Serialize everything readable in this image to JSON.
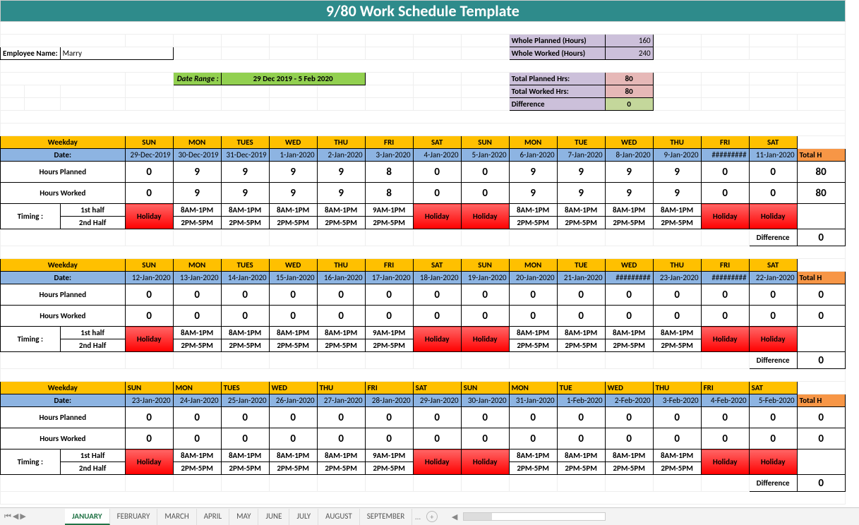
{
  "title": "9/80 Work Schedule Template",
  "emp_label": "Employee Name:",
  "emp_name": "Marry",
  "date_range_label": "Date Range :",
  "date_range_value": "29 Dec 2019 - 5 Feb 2020",
  "summary": {
    "whole_planned_lbl": "Whole Planned (Hours)",
    "whole_planned_val": "160",
    "whole_worked_lbl": "Whole Worked (Hours)",
    "whole_worked_val": "240",
    "total_planned_lbl": "Total Planned Hrs:",
    "total_planned_val": "80",
    "total_worked_lbl": "Total Worked Hrs:",
    "total_worked_val": "80",
    "diff_lbl": "Difference",
    "diff_val": "0"
  },
  "labels": {
    "weekday": "Weekday",
    "date": "Date:",
    "hp": "Hours Planned",
    "hw": "Hours Worked",
    "timing": "Timing :",
    "h1": "1st half",
    "h2": "2nd Half",
    "h1b": "1st Half",
    "diff": "Difference",
    "tot": "Total H"
  },
  "weeks": [
    {
      "days": [
        "SUN",
        "MON",
        "TUES",
        "WED",
        "THU",
        "FRI",
        "SAT",
        "SUN",
        "MON",
        "TUE",
        "WED",
        "THU",
        "FRI",
        "SAT"
      ],
      "dates": [
        "29-Dec-2019",
        "30-Dec-2019",
        "31-Dec-2019",
        "1-Jan-2020",
        "2-Jan-2020",
        "3-Jan-2020",
        "4-Jan-2020",
        "5-Jan-2020",
        "6-Jan-2020",
        "7-Jan-2020",
        "8-Jan-2020",
        "9-Jan-2020",
        "#########",
        "11-Jan-2020"
      ],
      "hp": [
        "0",
        "9",
        "9",
        "9",
        "9",
        "8",
        "0",
        "0",
        "9",
        "9",
        "9",
        "9",
        "0",
        "0"
      ],
      "hw": [
        "0",
        "9",
        "9",
        "9",
        "9",
        "8",
        "0",
        "0",
        "9",
        "9",
        "9",
        "9",
        "0",
        "0"
      ],
      "shift1": [
        "Holiday",
        "8AM-1PM",
        "8AM-1PM",
        "8AM-1PM",
        "8AM-1PM",
        "9AM-1PM",
        "Holiday",
        "Holiday",
        "8AM-1PM",
        "8AM-1PM",
        "8AM-1PM",
        "8AM-1PM",
        "Holiday",
        "Holiday"
      ],
      "shift2": [
        "",
        "2PM-5PM",
        "2PM-5PM",
        "2PM-5PM",
        "2PM-5PM",
        "2PM-5PM",
        "",
        "",
        "2PM-5PM",
        "2PM-5PM",
        "2PM-5PM",
        "2PM-5PM",
        "",
        ""
      ],
      "holiday": [
        true,
        false,
        false,
        false,
        false,
        false,
        true,
        true,
        false,
        false,
        false,
        false,
        true,
        true
      ],
      "thp": "80",
      "thw": "80",
      "diff": "0"
    },
    {
      "days": [
        "SUN",
        "MON",
        "TUES",
        "WED",
        "THU",
        "FRI",
        "SAT",
        "SUN",
        "MON",
        "TUE",
        "WED",
        "THU",
        "FRI",
        "SAT"
      ],
      "dates": [
        "12-Jan-2020",
        "13-Jan-2020",
        "14-Jan-2020",
        "15-Jan-2020",
        "16-Jan-2020",
        "17-Jan-2020",
        "18-Jan-2020",
        "19-Jan-2020",
        "20-Jan-2020",
        "21-Jan-2020",
        "#########",
        "23-Jan-2020",
        "#########",
        "22-Jan-2020"
      ],
      "hp": [
        "0",
        "0",
        "0",
        "0",
        "0",
        "0",
        "0",
        "0",
        "0",
        "0",
        "0",
        "0",
        "0",
        "0"
      ],
      "hw": [
        "0",
        "0",
        "0",
        "0",
        "0",
        "0",
        "0",
        "0",
        "0",
        "0",
        "0",
        "0",
        "0",
        "0"
      ],
      "shift1": [
        "Holiday",
        "8AM-1PM",
        "8AM-1PM",
        "8AM-1PM",
        "8AM-1PM",
        "9AM-1PM",
        "Holiday",
        "Holiday",
        "8AM-1PM",
        "8AM-1PM",
        "8AM-1PM",
        "8AM-1PM",
        "Holiday",
        "Holiday"
      ],
      "shift2": [
        "",
        "2PM-5PM",
        "2PM-5PM",
        "2PM-5PM",
        "2PM-5PM",
        "2PM-5PM",
        "",
        "",
        "2PM-5PM",
        "2PM-5PM",
        "2PM-5PM",
        "2PM-5PM",
        "",
        ""
      ],
      "holiday": [
        true,
        false,
        false,
        false,
        false,
        false,
        true,
        true,
        false,
        false,
        false,
        false,
        true,
        true
      ],
      "thp": "0",
      "thw": "0",
      "diff": "0"
    },
    {
      "days": [
        "SUN",
        "MON",
        "TUES",
        "WED",
        "THU",
        "FRI",
        "SAT",
        "SUN",
        "MON",
        "TUE",
        "WED",
        "THU",
        "FRI",
        "SAT"
      ],
      "dates": [
        "23-Jan-2020",
        "24-Jan-2020",
        "25-Jan-2020",
        "26-Jan-2020",
        "27-Jan-2020",
        "28-Jan-2020",
        "29-Jan-2020",
        "30-Jan-2020",
        "31-Jan-2020",
        "1-Feb-2020",
        "2-Feb-2020",
        "3-Feb-2020",
        "4-Feb-2020",
        "5-Feb-2020"
      ],
      "hp": [
        "0",
        "0",
        "0",
        "0",
        "0",
        "0",
        "0",
        "0",
        "0",
        "0",
        "0",
        "0",
        "0",
        "0"
      ],
      "hw": [
        "0",
        "0",
        "0",
        "0",
        "0",
        "0",
        "0",
        "0",
        "0",
        "0",
        "0",
        "0",
        "0",
        "0"
      ],
      "shift1": [
        "Holiday",
        "8AM-1PM",
        "8AM-1PM",
        "8AM-1PM",
        "8AM-1PM",
        "9AM-1PM",
        "Holiday",
        "Holiday",
        "8AM-1PM",
        "8AM-1PM",
        "8AM-1PM",
        "8AM-1PM",
        "Holiday",
        "Holiday"
      ],
      "shift2": [
        "",
        "2PM-5PM",
        "2PM-5PM",
        "2PM-5PM",
        "2PM-5PM",
        "2PM-5PM",
        "",
        "",
        "2PM-5PM",
        "2PM-5PM",
        "2PM-5PM",
        "2PM-5PM",
        "",
        ""
      ],
      "holiday": [
        true,
        false,
        false,
        false,
        false,
        false,
        true,
        true,
        false,
        false,
        false,
        false,
        true,
        true
      ],
      "left_align_days": true,
      "thp": "0",
      "thw": "0",
      "diff": "0"
    }
  ],
  "tabs": [
    "JANUARY",
    "FEBRUARY",
    "MARCH",
    "APRIL",
    "MAY",
    "JUNE",
    "JULY",
    "AUGUST",
    "SEPTEMBER"
  ],
  "active_tab": "JANUARY"
}
